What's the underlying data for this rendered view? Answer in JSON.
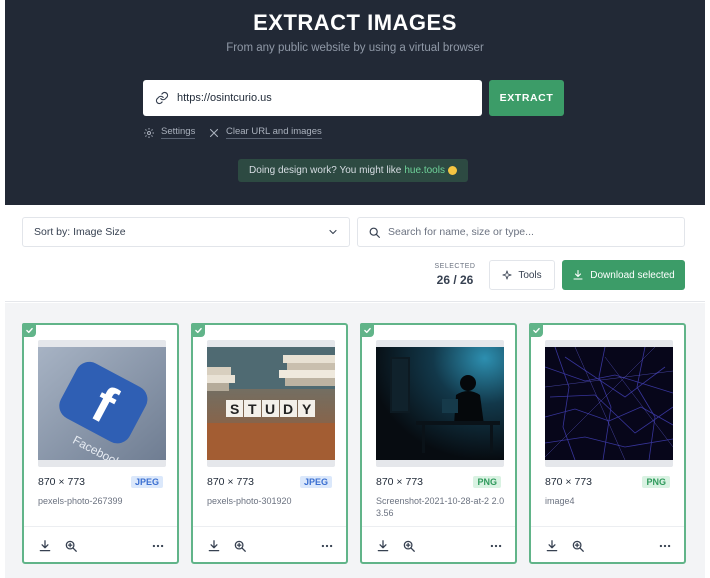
{
  "hero": {
    "title": "EXTRACT IMAGES",
    "subtitle": "From any public website by using a virtual browser",
    "url_value": "https://osintcurio.us",
    "extract_label": "EXTRACT",
    "settings_label": "Settings",
    "clear_label": "Clear URL and images",
    "promo_text": "Doing design work? You might like",
    "promo_link": "hue.tools"
  },
  "toolbar": {
    "sort_label": "Sort by: Image Size",
    "search_placeholder": "Search for name, size or type...",
    "selected_label": "SELECTED",
    "selected_count": "26 / 26",
    "tools_label": "Tools",
    "download_label": "Download selected"
  },
  "cards": [
    {
      "dims": "870 × 773",
      "type": "JPEG",
      "name": "pexels-photo-267399"
    },
    {
      "dims": "870 × 773",
      "type": "JPEG",
      "name": "pexels-photo-301920"
    },
    {
      "dims": "870 × 773",
      "type": "PNG",
      "name": "Screenshot-2021-10-28-at-2 2.03.56"
    },
    {
      "dims": "870 × 773",
      "type": "PNG",
      "name": "image4"
    }
  ],
  "thumb_text": {
    "study": [
      "S",
      "T",
      "U",
      "D",
      "Y"
    ],
    "facebook_letter": "f",
    "facebook_word": "Facebook"
  },
  "colors": {
    "hero_bg": "#222936",
    "accent_green": "#3c9c68",
    "card_border": "#61b489"
  }
}
